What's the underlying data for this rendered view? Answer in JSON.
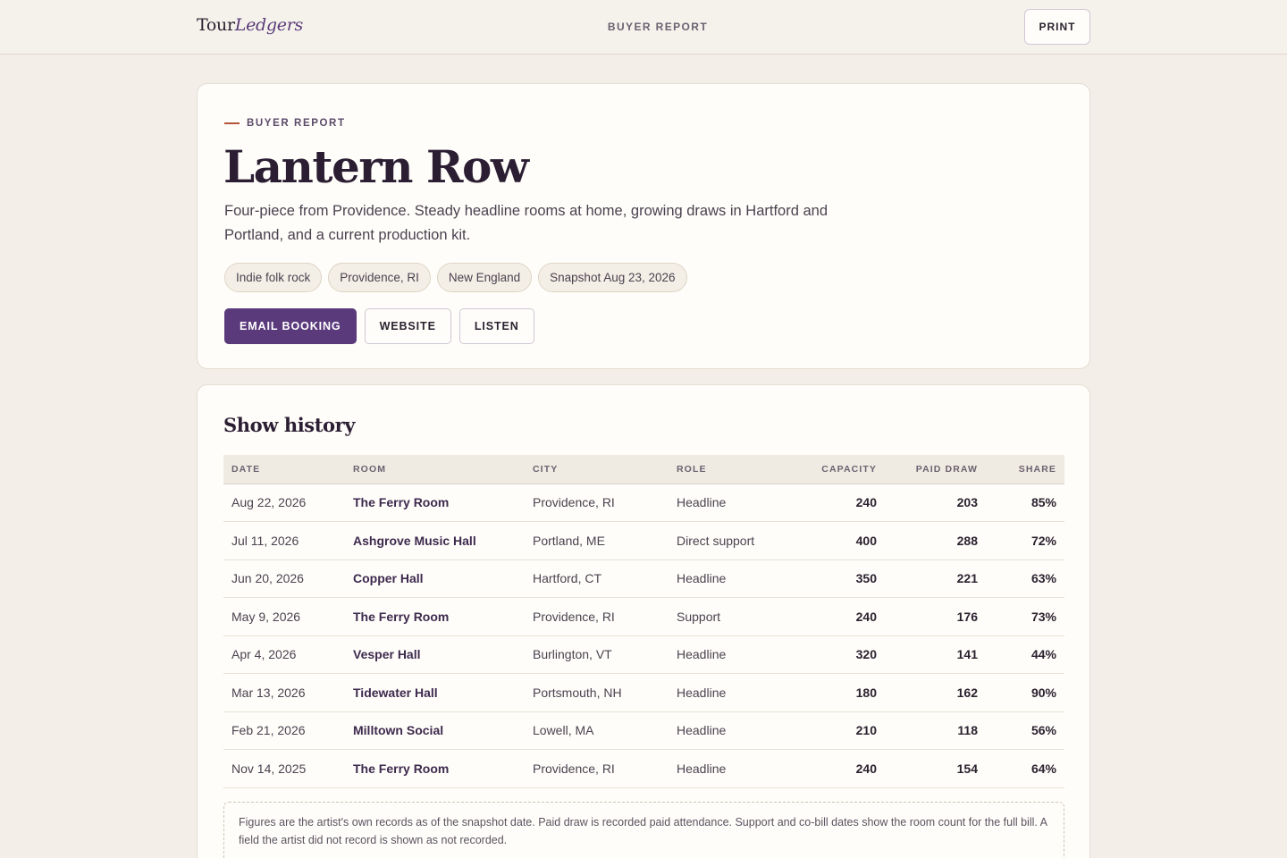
{
  "header": {
    "logo_part1": "Tour",
    "logo_part2": "Ledgers",
    "nav_title": "BUYER REPORT",
    "print_label": "PRINT"
  },
  "hero": {
    "eyebrow": "BUYER REPORT",
    "artist_name": "Lantern Row",
    "description": "Four-piece from Providence. Steady headline rooms at home, growing draws in Hartford and Portland, and a current production kit.",
    "tags": [
      "Indie folk rock",
      "Providence, RI",
      "New England",
      "Snapshot Aug 23, 2026"
    ],
    "actions": {
      "email_booking": "EMAIL BOOKING",
      "website": "WEBSITE",
      "listen": "LISTEN"
    }
  },
  "history": {
    "title": "Show history",
    "columns": [
      "DATE",
      "ROOM",
      "CITY",
      "ROLE",
      "CAPACITY",
      "PAID DRAW",
      "SHARE"
    ],
    "rows": [
      {
        "date": "Aug 22, 2026",
        "room": "The Ferry Room",
        "city": "Providence, RI",
        "role": "Headline",
        "capacity": "240",
        "paid_draw": "203",
        "share": "85%"
      },
      {
        "date": "Jul 11, 2026",
        "room": "Ashgrove Music Hall",
        "city": "Portland, ME",
        "role": "Direct support",
        "capacity": "400",
        "paid_draw": "288",
        "share": "72%"
      },
      {
        "date": "Jun 20, 2026",
        "room": "Copper Hall",
        "city": "Hartford, CT",
        "role": "Headline",
        "capacity": "350",
        "paid_draw": "221",
        "share": "63%"
      },
      {
        "date": "May 9, 2026",
        "room": "The Ferry Room",
        "city": "Providence, RI",
        "role": "Support",
        "capacity": "240",
        "paid_draw": "176",
        "share": "73%"
      },
      {
        "date": "Apr 4, 2026",
        "room": "Vesper Hall",
        "city": "Burlington, VT",
        "role": "Headline",
        "capacity": "320",
        "paid_draw": "141",
        "share": "44%"
      },
      {
        "date": "Mar 13, 2026",
        "room": "Tidewater Hall",
        "city": "Portsmouth, NH",
        "role": "Headline",
        "capacity": "180",
        "paid_draw": "162",
        "share": "90%"
      },
      {
        "date": "Feb 21, 2026",
        "room": "Milltown Social",
        "city": "Lowell, MA",
        "role": "Headline",
        "capacity": "210",
        "paid_draw": "118",
        "share": "56%"
      },
      {
        "date": "Nov 14, 2025",
        "room": "The Ferry Room",
        "city": "Providence, RI",
        "role": "Headline",
        "capacity": "240",
        "paid_draw": "154",
        "share": "64%"
      }
    ],
    "note": "Figures are the artist's own records as of the snapshot date. Paid draw is recorded paid attendance. Support and co-bill dates show the room count for the full bill. A field the artist did not record is shown as not recorded."
  },
  "colors": {
    "accent": "#5b3a7c",
    "eyebrow_dash": "#b5533a",
    "background": "#f3efe8",
    "card": "#fffdf9"
  }
}
